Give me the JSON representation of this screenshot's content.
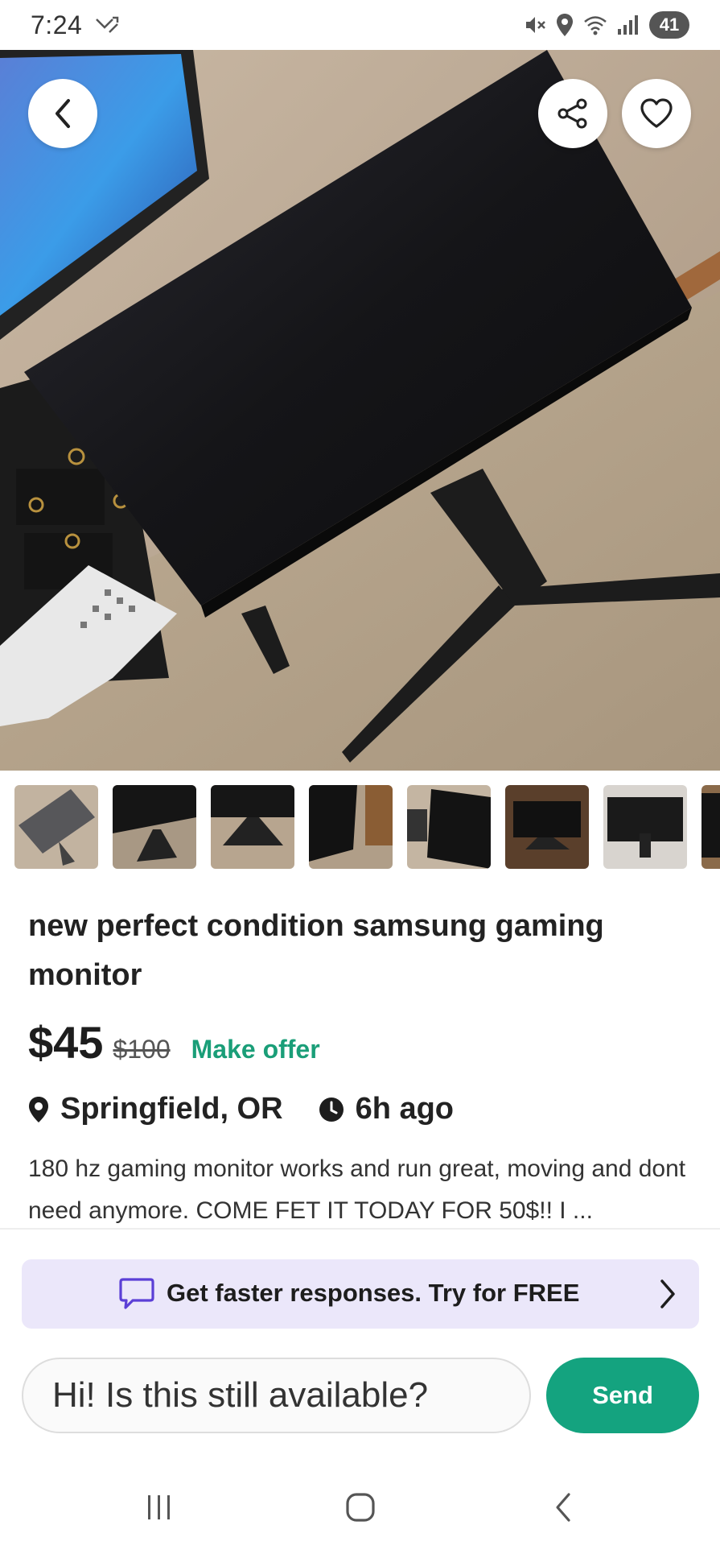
{
  "status_bar": {
    "time": "7:24",
    "battery": "41"
  },
  "listing": {
    "title": "new perfect condition samsung gaming monitor",
    "price": "$45",
    "original_price": "$100",
    "make_offer": "Make offer",
    "location": "Springfield, OR",
    "posted": "6h ago",
    "description": "180 hz gaming monitor works and run great, moving and dont need anymore. COME FET IT TODAY FOR 50$!! I ..."
  },
  "thumbnails_count": 8,
  "promo": {
    "text": "Get faster responses.  Try for FREE"
  },
  "message": {
    "value": "Hi! Is this still available?",
    "send_label": "Send"
  },
  "colors": {
    "accent": "#14a37f",
    "promo_bg": "#ebe7fa",
    "offer": "#1a9e78"
  },
  "icons": {
    "back": "chevron-left-icon",
    "share": "share-icon",
    "favorite": "heart-icon",
    "location": "map-pin-icon",
    "time": "clock-icon",
    "chat": "chat-bubble-icon"
  }
}
